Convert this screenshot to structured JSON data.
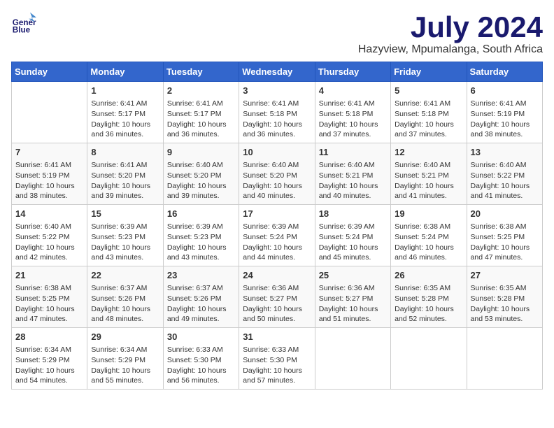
{
  "header": {
    "logo_line1": "General",
    "logo_line2": "Blue",
    "title": "July 2024",
    "subtitle": "Hazyview, Mpumalanga, South Africa"
  },
  "days": [
    "Sunday",
    "Monday",
    "Tuesday",
    "Wednesday",
    "Thursday",
    "Friday",
    "Saturday"
  ],
  "weeks": [
    [
      {
        "date": "",
        "info": ""
      },
      {
        "date": "1",
        "info": "Sunrise: 6:41 AM\nSunset: 5:17 PM\nDaylight: 10 hours\nand 36 minutes."
      },
      {
        "date": "2",
        "info": "Sunrise: 6:41 AM\nSunset: 5:17 PM\nDaylight: 10 hours\nand 36 minutes."
      },
      {
        "date": "3",
        "info": "Sunrise: 6:41 AM\nSunset: 5:18 PM\nDaylight: 10 hours\nand 36 minutes."
      },
      {
        "date": "4",
        "info": "Sunrise: 6:41 AM\nSunset: 5:18 PM\nDaylight: 10 hours\nand 37 minutes."
      },
      {
        "date": "5",
        "info": "Sunrise: 6:41 AM\nSunset: 5:18 PM\nDaylight: 10 hours\nand 37 minutes."
      },
      {
        "date": "6",
        "info": "Sunrise: 6:41 AM\nSunset: 5:19 PM\nDaylight: 10 hours\nand 38 minutes."
      }
    ],
    [
      {
        "date": "7",
        "info": "Sunrise: 6:41 AM\nSunset: 5:19 PM\nDaylight: 10 hours\nand 38 minutes."
      },
      {
        "date": "8",
        "info": "Sunrise: 6:41 AM\nSunset: 5:20 PM\nDaylight: 10 hours\nand 39 minutes."
      },
      {
        "date": "9",
        "info": "Sunrise: 6:40 AM\nSunset: 5:20 PM\nDaylight: 10 hours\nand 39 minutes."
      },
      {
        "date": "10",
        "info": "Sunrise: 6:40 AM\nSunset: 5:20 PM\nDaylight: 10 hours\nand 40 minutes."
      },
      {
        "date": "11",
        "info": "Sunrise: 6:40 AM\nSunset: 5:21 PM\nDaylight: 10 hours\nand 40 minutes."
      },
      {
        "date": "12",
        "info": "Sunrise: 6:40 AM\nSunset: 5:21 PM\nDaylight: 10 hours\nand 41 minutes."
      },
      {
        "date": "13",
        "info": "Sunrise: 6:40 AM\nSunset: 5:22 PM\nDaylight: 10 hours\nand 41 minutes."
      }
    ],
    [
      {
        "date": "14",
        "info": "Sunrise: 6:40 AM\nSunset: 5:22 PM\nDaylight: 10 hours\nand 42 minutes."
      },
      {
        "date": "15",
        "info": "Sunrise: 6:39 AM\nSunset: 5:23 PM\nDaylight: 10 hours\nand 43 minutes."
      },
      {
        "date": "16",
        "info": "Sunrise: 6:39 AM\nSunset: 5:23 PM\nDaylight: 10 hours\nand 43 minutes."
      },
      {
        "date": "17",
        "info": "Sunrise: 6:39 AM\nSunset: 5:24 PM\nDaylight: 10 hours\nand 44 minutes."
      },
      {
        "date": "18",
        "info": "Sunrise: 6:39 AM\nSunset: 5:24 PM\nDaylight: 10 hours\nand 45 minutes."
      },
      {
        "date": "19",
        "info": "Sunrise: 6:38 AM\nSunset: 5:24 PM\nDaylight: 10 hours\nand 46 minutes."
      },
      {
        "date": "20",
        "info": "Sunrise: 6:38 AM\nSunset: 5:25 PM\nDaylight: 10 hours\nand 47 minutes."
      }
    ],
    [
      {
        "date": "21",
        "info": "Sunrise: 6:38 AM\nSunset: 5:25 PM\nDaylight: 10 hours\nand 47 minutes."
      },
      {
        "date": "22",
        "info": "Sunrise: 6:37 AM\nSunset: 5:26 PM\nDaylight: 10 hours\nand 48 minutes."
      },
      {
        "date": "23",
        "info": "Sunrise: 6:37 AM\nSunset: 5:26 PM\nDaylight: 10 hours\nand 49 minutes."
      },
      {
        "date": "24",
        "info": "Sunrise: 6:36 AM\nSunset: 5:27 PM\nDaylight: 10 hours\nand 50 minutes."
      },
      {
        "date": "25",
        "info": "Sunrise: 6:36 AM\nSunset: 5:27 PM\nDaylight: 10 hours\nand 51 minutes."
      },
      {
        "date": "26",
        "info": "Sunrise: 6:35 AM\nSunset: 5:28 PM\nDaylight: 10 hours\nand 52 minutes."
      },
      {
        "date": "27",
        "info": "Sunrise: 6:35 AM\nSunset: 5:28 PM\nDaylight: 10 hours\nand 53 minutes."
      }
    ],
    [
      {
        "date": "28",
        "info": "Sunrise: 6:34 AM\nSunset: 5:29 PM\nDaylight: 10 hours\nand 54 minutes."
      },
      {
        "date": "29",
        "info": "Sunrise: 6:34 AM\nSunset: 5:29 PM\nDaylight: 10 hours\nand 55 minutes."
      },
      {
        "date": "30",
        "info": "Sunrise: 6:33 AM\nSunset: 5:30 PM\nDaylight: 10 hours\nand 56 minutes."
      },
      {
        "date": "31",
        "info": "Sunrise: 6:33 AM\nSunset: 5:30 PM\nDaylight: 10 hours\nand 57 minutes."
      },
      {
        "date": "",
        "info": ""
      },
      {
        "date": "",
        "info": ""
      },
      {
        "date": "",
        "info": ""
      }
    ]
  ]
}
